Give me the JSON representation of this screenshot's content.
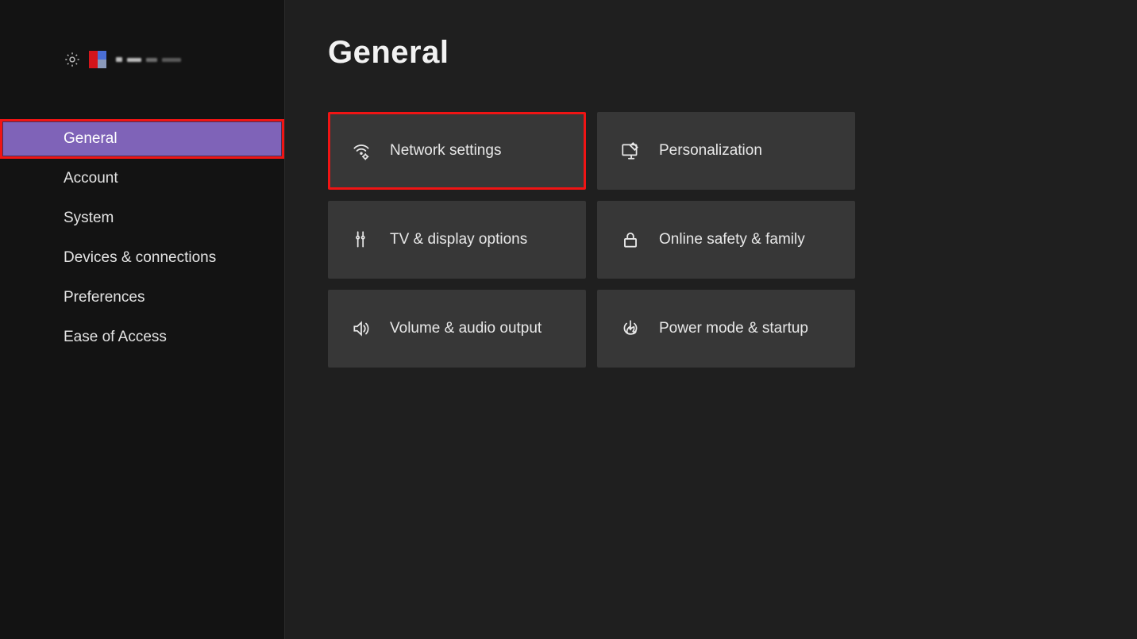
{
  "page": {
    "title": "General"
  },
  "sidebar": {
    "items": [
      {
        "label": "General"
      },
      {
        "label": "Account"
      },
      {
        "label": "System"
      },
      {
        "label": "Devices & connections"
      },
      {
        "label": "Preferences"
      },
      {
        "label": "Ease of Access"
      }
    ]
  },
  "tiles": {
    "network": {
      "label": "Network settings"
    },
    "personalization": {
      "label": "Personalization"
    },
    "tv": {
      "label": "TV & display options"
    },
    "safety": {
      "label": "Online safety & family"
    },
    "audio": {
      "label": "Volume & audio output"
    },
    "power": {
      "label": "Power mode & startup"
    }
  }
}
